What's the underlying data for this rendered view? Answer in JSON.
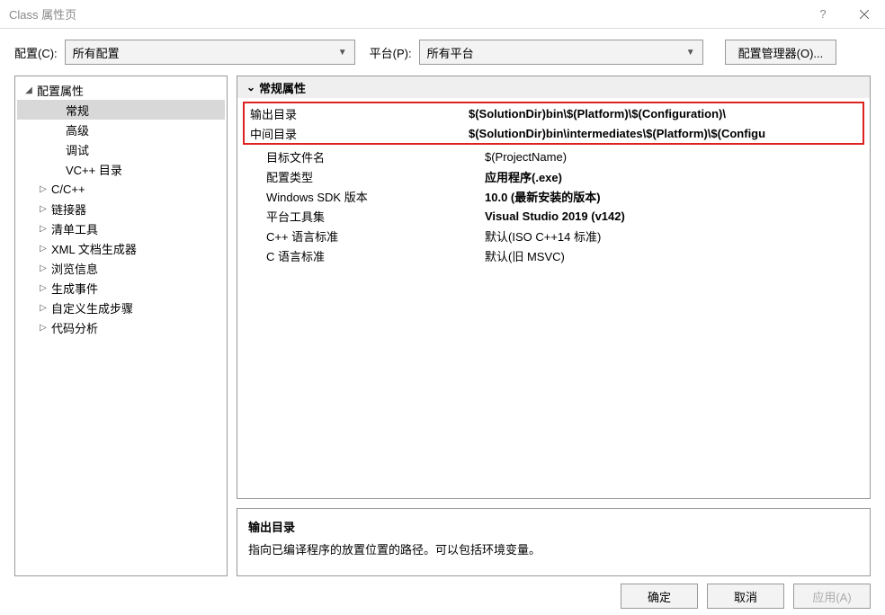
{
  "titlebar": {
    "title": "Class 属性页"
  },
  "toolbar": {
    "config_label": "配置(C):",
    "config_value": "所有配置",
    "platform_label": "平台(P):",
    "platform_value": "所有平台",
    "config_manager": "配置管理器(O)..."
  },
  "tree": [
    {
      "label": "配置属性",
      "level": 0,
      "expander": "down",
      "selected": false
    },
    {
      "label": "常规",
      "level": 2,
      "expander": "blank",
      "selected": true
    },
    {
      "label": "高级",
      "level": 2,
      "expander": "blank"
    },
    {
      "label": "调试",
      "level": 2,
      "expander": "blank"
    },
    {
      "label": "VC++ 目录",
      "level": 2,
      "expander": "blank"
    },
    {
      "label": "C/C++",
      "level": 1,
      "expander": "right"
    },
    {
      "label": "链接器",
      "level": 1,
      "expander": "right"
    },
    {
      "label": "清单工具",
      "level": 1,
      "expander": "right"
    },
    {
      "label": "XML 文档生成器",
      "level": 1,
      "expander": "right"
    },
    {
      "label": "浏览信息",
      "level": 1,
      "expander": "right"
    },
    {
      "label": "生成事件",
      "level": 1,
      "expander": "right"
    },
    {
      "label": "自定义生成步骤",
      "level": 1,
      "expander": "right"
    },
    {
      "label": "代码分析",
      "level": 1,
      "expander": "right"
    }
  ],
  "grid": {
    "group_header": "常规属性",
    "highlighted": [
      {
        "key": "输出目录",
        "val": "$(SolutionDir)bin\\$(Platform)\\$(Configuration)\\",
        "bold": true
      },
      {
        "key": "中间目录",
        "val": "$(SolutionDir)bin\\intermediates\\$(Platform)\\$(Configu",
        "bold": true
      }
    ],
    "rows": [
      {
        "key": "目标文件名",
        "val": "$(ProjectName)",
        "bold": false
      },
      {
        "key": "配置类型",
        "val": "应用程序(.exe)",
        "bold": true
      },
      {
        "key": "Windows SDK 版本",
        "val": "10.0 (最新安装的版本)",
        "bold": true
      },
      {
        "key": "平台工具集",
        "val": "Visual Studio 2019 (v142)",
        "bold": true
      },
      {
        "key": "C++ 语言标准",
        "val": "默认(ISO C++14 标准)",
        "bold": false
      },
      {
        "key": "C 语言标准",
        "val": "默认(旧 MSVC)",
        "bold": false
      }
    ]
  },
  "help": {
    "title": "输出目录",
    "desc": "指向已编译程序的放置位置的路径。可以包括环境变量。"
  },
  "footer": {
    "ok": "确定",
    "cancel": "取消",
    "apply": "应用(A)"
  }
}
